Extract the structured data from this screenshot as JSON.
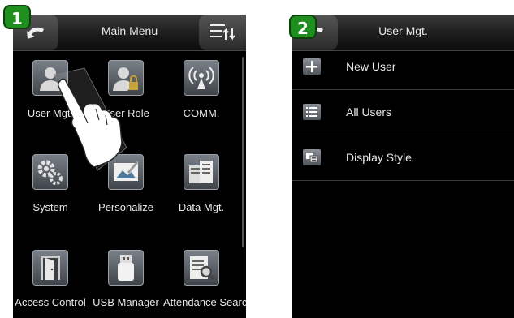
{
  "steps": [
    "1",
    "2"
  ],
  "screen1": {
    "title": "Main Menu",
    "items": [
      {
        "label": "User Mgt.",
        "icon": "user-icon"
      },
      {
        "label": "User Role",
        "icon": "user-role-icon"
      },
      {
        "label": "COMM.",
        "icon": "comm-icon"
      },
      {
        "label": "System",
        "icon": "system-gears-icon"
      },
      {
        "label": "Personalize",
        "icon": "personalize-icon"
      },
      {
        "label": "Data Mgt.",
        "icon": "data-mgt-icon"
      },
      {
        "label": "Access Control",
        "icon": "access-control-icon"
      },
      {
        "label": "USB Manager",
        "icon": "usb-icon"
      },
      {
        "label": "Attendance Search",
        "icon": "attendance-search-icon"
      }
    ]
  },
  "screen2": {
    "title": "User Mgt.",
    "items": [
      {
        "label": "New User",
        "icon": "plus-icon"
      },
      {
        "label": "All Users",
        "icon": "list-icon"
      },
      {
        "label": "Display Style",
        "icon": "display-style-icon"
      }
    ]
  },
  "colors": {
    "badge": "#1f8f1f",
    "screen": "#000000",
    "text": "#e8e8e8"
  }
}
